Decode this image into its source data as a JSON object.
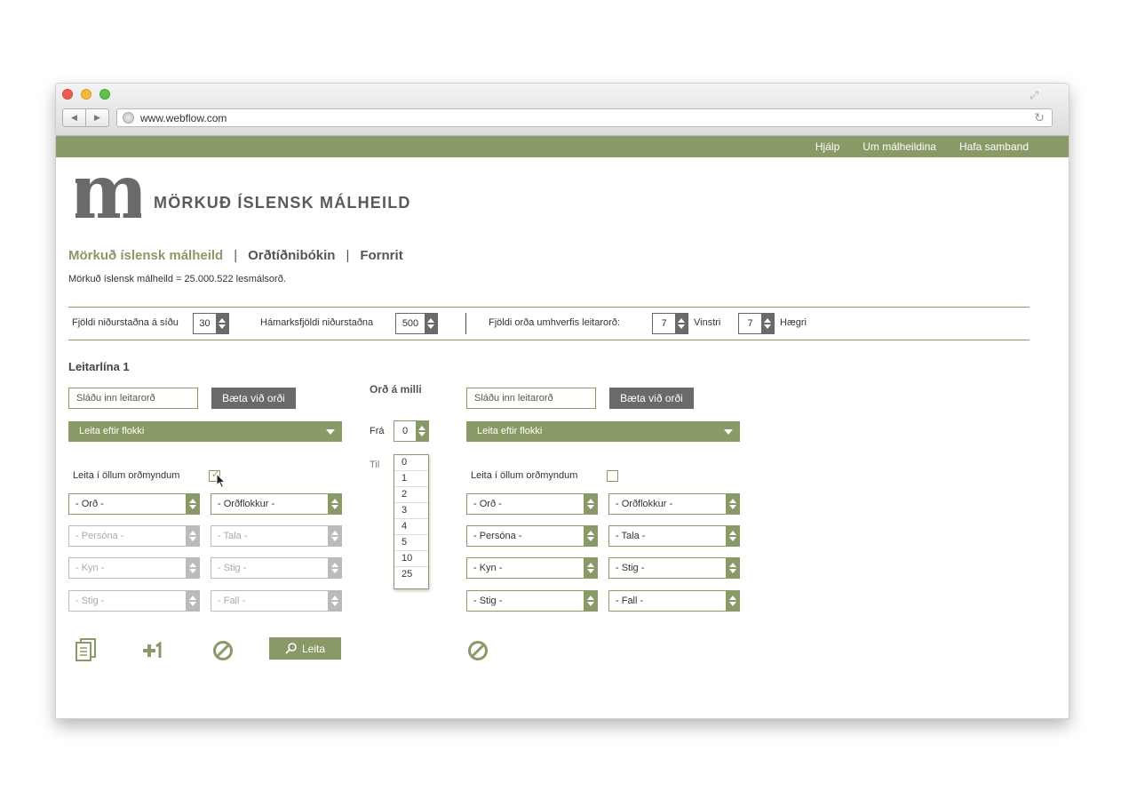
{
  "browser": {
    "url": "www.webflow.com"
  },
  "topnav": {
    "links": [
      "Hjálp",
      "Um málheildina",
      "Hafa samband"
    ]
  },
  "logo": {
    "letter": "m",
    "title": "MÖRKUÐ ÍSLENSK MÁLHEILD"
  },
  "secnav": {
    "active": "Mörkuð íslensk málheild",
    "sep": "|",
    "items": [
      "Orðtíðnibókin",
      "Fornrit"
    ]
  },
  "subtitle": "Mörkuð íslensk málheild = 25.000.522 lesmálsorð.",
  "settings": {
    "per_page_label": "Fjöldi niðurstaðna á síðu",
    "per_page_value": "30",
    "max_label": "Hámarksfjöldi niðurstaðna",
    "max_value": "500",
    "context_label": "Fjöldi orða umhverfis leitarorð:",
    "left_value": "7",
    "left_label": "Vinstri",
    "right_value": "7",
    "right_label": "Hægri"
  },
  "search": {
    "heading": "Leitarlína 1",
    "input_placeholder": "Sláðu inn leitarorð",
    "add_word_button": "Bæta við orði",
    "category_select": "Leita eftir flokki",
    "all_forms_label": "Leita í öllum orðmyndum",
    "left_selects": [
      "- Orð -",
      "- Orðflokkur -",
      "- Persóna -",
      "- Tala -",
      "- Kyn -",
      "- Stig -",
      "- Stig  -",
      "- Fall -"
    ],
    "right_selects": [
      "- Orð -",
      "- Orðflokkur -",
      "- Persóna -",
      "- Tala -",
      "- Kyn -",
      "- Stig -",
      "- Stig  -",
      "- Fall -"
    ],
    "left_all_forms_checked": true,
    "right_all_forms_checked": false
  },
  "between": {
    "heading": "Orð á milli",
    "from_label": "Frá",
    "from_value": "0",
    "to_label": "Til",
    "to_options": [
      "0",
      "1",
      "2",
      "3",
      "4",
      "5",
      "10",
      "25"
    ]
  },
  "actions": {
    "search_button": "Leita"
  },
  "colors": {
    "accent": "#8a9a66",
    "dark": "#6a6a6a"
  }
}
